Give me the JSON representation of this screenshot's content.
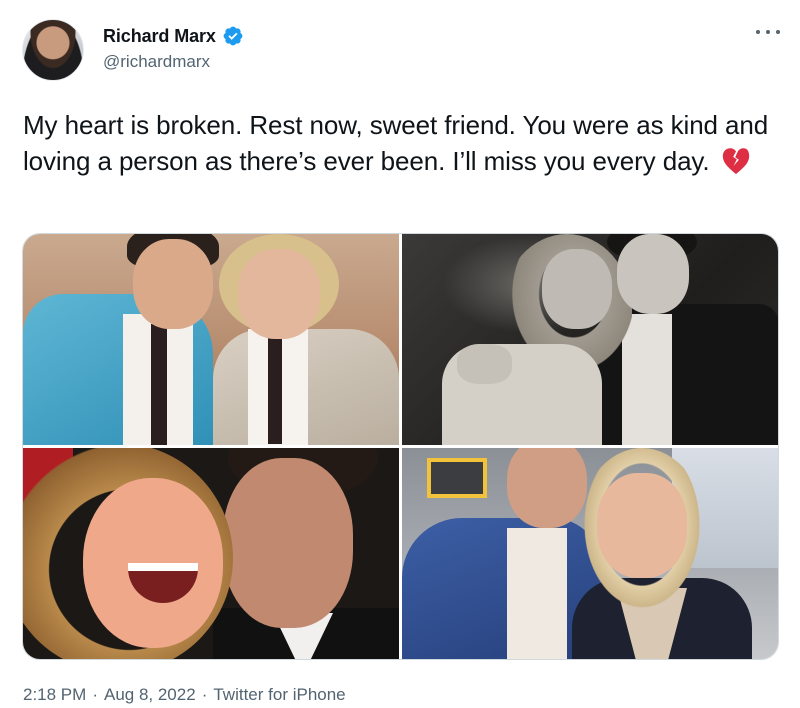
{
  "author": {
    "display_name": "Richard Marx",
    "handle": "@richardmarx",
    "verified": true,
    "avatar_icon": "profile-photo"
  },
  "tweet": {
    "text": "My heart is broken. Rest now, sweet friend. You were as kind and loving a person as there’s ever been. I’ll miss you every day.",
    "emoji_icon": "broken-heart-icon"
  },
  "media": {
    "photo_count": 4
  },
  "meta": {
    "time": "2:18 PM",
    "date": "Aug 8, 2022",
    "source": "Twitter for iPhone",
    "separator": "·"
  },
  "colors": {
    "verified_blue": "#1d9bf0",
    "text_primary": "#0f1419",
    "text_secondary": "#536471",
    "broken_heart_red": "#dd2e44"
  }
}
